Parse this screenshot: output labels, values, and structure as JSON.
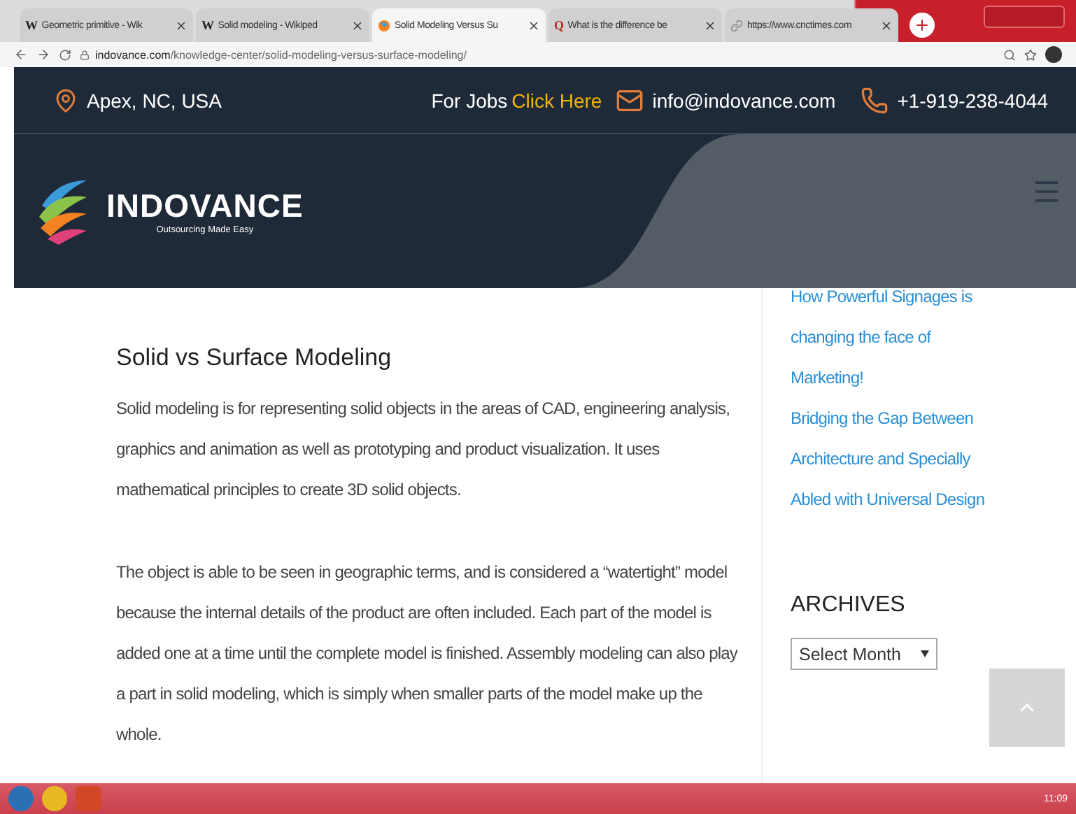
{
  "browser": {
    "tabs": [
      {
        "kind": "letter",
        "favicon": "W",
        "label": "Geometric primitive - Wik",
        "selected": false
      },
      {
        "kind": "letter",
        "favicon": "W",
        "label": "Solid modeling - Wikiped",
        "selected": false
      },
      {
        "kind": "logo",
        "label": "Solid Modeling Versus Su",
        "selected": true
      },
      {
        "kind": "letter",
        "favicon": "Q",
        "label": "What is the difference be",
        "selected": false
      },
      {
        "kind": "link",
        "label": "https://www.cnctimes.com",
        "selected": false
      }
    ],
    "address_host": "indovance.com",
    "address_path": "/knowledge-center/solid-modeling-versus-surface-modeling/"
  },
  "topbar": {
    "location": "Apex, NC, USA",
    "jobs_label": "For Jobs",
    "jobs_link": "Click Here",
    "email": "info@indovance.com",
    "phone": "+1-919-238-4044"
  },
  "logo": {
    "name": "INDOVANCE",
    "tagline": "Outsourcing Made Easy"
  },
  "article": {
    "heading": "Solid vs Surface Modeling",
    "paragraphs": [
      "Solid modeling is for representing solid objects in the areas of CAD, engineering analysis, graphics and animation as well as prototyping and product visualization. It uses mathematical principles to create 3D solid objects.",
      "The object is able to be seen in geographic terms, and is considered a “watertight” model because the internal details of the product are often included. Each part of the model is added one at a time until the complete model is finished. Assembly modeling can also play a part in solid modeling, which is simply when smaller parts of the model make up the whole."
    ]
  },
  "sidebar": {
    "links": [
      "How Powerful Signages is changing the face of Marketing!",
      "Bridging the Gap Between Architecture and Specially Abled with Universal Design"
    ],
    "archives_heading": "ARCHIVES",
    "archives_select": "Select Month"
  },
  "taskbar": {
    "clock": "11:09"
  }
}
